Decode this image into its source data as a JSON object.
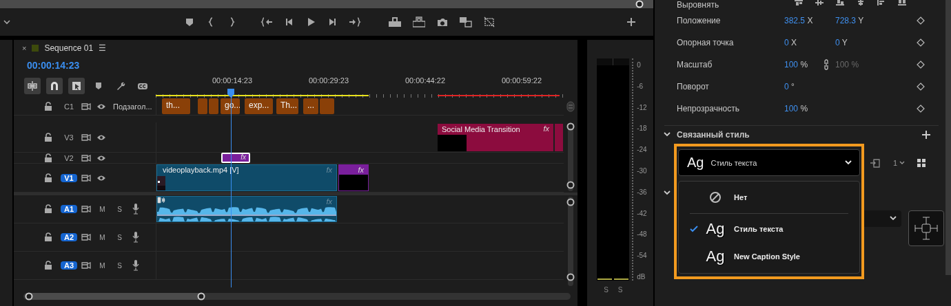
{
  "timeline": {
    "tab": {
      "close": "×",
      "title": "Sequence 01",
      "menu": "☰"
    },
    "timecode": "00:00:14:23",
    "ruler": [
      "00:00:14:23",
      "00:00:29:23",
      "00:00:44:22",
      "00:00:59:22"
    ],
    "tracks": [
      {
        "kind": "caption",
        "name": "C1",
        "targeted": false,
        "label": "Подзагол...",
        "clips": [
          {
            "kind": "caption",
            "text": "th...",
            "selected": false
          },
          {
            "kind": "caption",
            "selected": false
          },
          {
            "kind": "caption",
            "selected": false
          },
          {
            "kind": "caption",
            "text": "go...",
            "selected": false
          },
          {
            "kind": "caption",
            "text": "exp...",
            "selected": false
          },
          {
            "kind": "caption",
            "text": "Th...",
            "selected": false
          },
          {
            "kind": "caption",
            "text": "...",
            "selected": false
          },
          {
            "kind": "caption",
            "selected": false
          }
        ]
      },
      {
        "kind": "video",
        "name": "V3",
        "targeted": false,
        "clips": [
          {
            "kind": "graphic",
            "title": "Social Media Transition",
            "badge": "fx",
            "selected": false
          },
          {
            "kind": "graphic",
            "selected": false
          }
        ]
      },
      {
        "kind": "video",
        "name": "V2",
        "targeted": false,
        "clips": [
          {
            "kind": "adjustment",
            "badge": "fx",
            "selected": true
          }
        ]
      },
      {
        "kind": "video",
        "name": "V1",
        "targeted": true,
        "clips": [
          {
            "kind": "video",
            "title": "videoplayback.mp4 [V]",
            "badge": "fx",
            "selected": false
          },
          {
            "kind": "graphic_short",
            "badge": "fx",
            "selected": false
          }
        ]
      },
      {
        "kind": "audio",
        "name": "A1",
        "targeted": true,
        "mute": "M",
        "solo": "S",
        "clips": [
          {
            "kind": "audio",
            "badge": "fx",
            "selected": false
          }
        ]
      },
      {
        "kind": "audio",
        "name": "A2",
        "targeted": true,
        "mute": "M",
        "solo": "S"
      },
      {
        "kind": "audio",
        "name": "A3",
        "targeted": true,
        "mute": "M",
        "solo": "S"
      }
    ]
  },
  "meter": {
    "scale": [
      "0",
      "-6",
      "-12",
      "-18",
      "-24",
      "-30",
      "-36",
      "-42",
      "-48",
      "-54"
    ],
    "unit": "dB",
    "solo": [
      "S",
      "S"
    ]
  },
  "properties": {
    "rows": [
      {
        "kind": "align",
        "label": "Выровнять"
      },
      {
        "kind": "pair",
        "label": "Положение",
        "fields": [
          {
            "value": "382.5",
            "unit": "X",
            "disabled": false
          },
          {
            "value": "728.3",
            "unit": "Y",
            "disabled": false
          }
        ]
      },
      {
        "kind": "pair",
        "label": "Опорная точка",
        "fields": [
          {
            "value": "0",
            "unit": "X",
            "disabled": false
          },
          {
            "value": "0",
            "unit": "Y",
            "disabled": false
          }
        ]
      },
      {
        "kind": "linked",
        "label": "Масштаб",
        "fields": [
          {
            "value": "100",
            "unit": "%",
            "disabled": false
          },
          {
            "value": "100",
            "unit": "%",
            "disabled": true
          }
        ]
      },
      {
        "kind": "single",
        "label": "Поворот",
        "fields": [
          {
            "value": "0",
            "unit": "°",
            "disabled": false
          }
        ]
      },
      {
        "kind": "single",
        "label": "Непрозрачность",
        "fields": [
          {
            "value": "100",
            "unit": "%",
            "disabled": false
          }
        ]
      }
    ]
  },
  "linked_style": {
    "title": "Связанный стиль",
    "dropdown": {
      "glyph": "Ag",
      "value": "Стиль текста"
    },
    "count": "1",
    "menu": [
      {
        "kind": "none",
        "label": "Нет",
        "selected": false
      },
      {
        "kind": "style",
        "glyph": "Ag",
        "label": "Стиль текста",
        "selected": true
      },
      {
        "kind": "style",
        "glyph": "Ag",
        "label": "New Caption Style",
        "selected": false
      }
    ]
  }
}
